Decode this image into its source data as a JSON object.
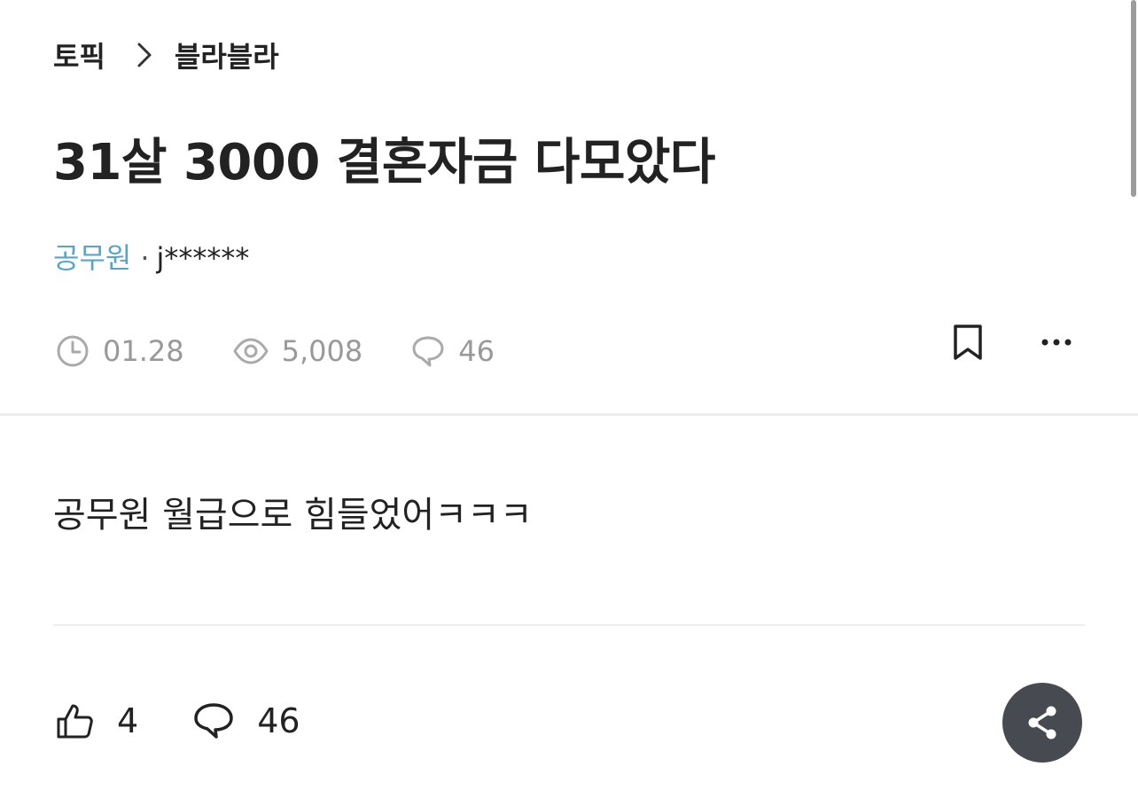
{
  "breadcrumb": {
    "root": "토픽",
    "topic": "블라블라"
  },
  "post": {
    "title": "31살 3000 결혼자금 다모았다",
    "company": "공무원",
    "separator": "·",
    "nickname": "j******",
    "date": "01.28",
    "views": "5,008",
    "comments": "46",
    "body": "공무원 월급으로 힘들었어ㅋㅋㅋ"
  },
  "reactions": {
    "likes": "4",
    "comments": "46"
  },
  "icons": {
    "breadcrumb_separator": "chevron-right-icon",
    "date": "clock-icon",
    "views": "eye-icon",
    "comments": "speech-bubble-icon",
    "bookmark": "bookmark-icon",
    "more": "more-dots-icon",
    "like": "thumbs-up-icon",
    "share": "share-icon"
  },
  "colors": {
    "company": "#5aa4c4",
    "meta": "#999999",
    "share_button": "#474a51",
    "text": "#222222"
  }
}
